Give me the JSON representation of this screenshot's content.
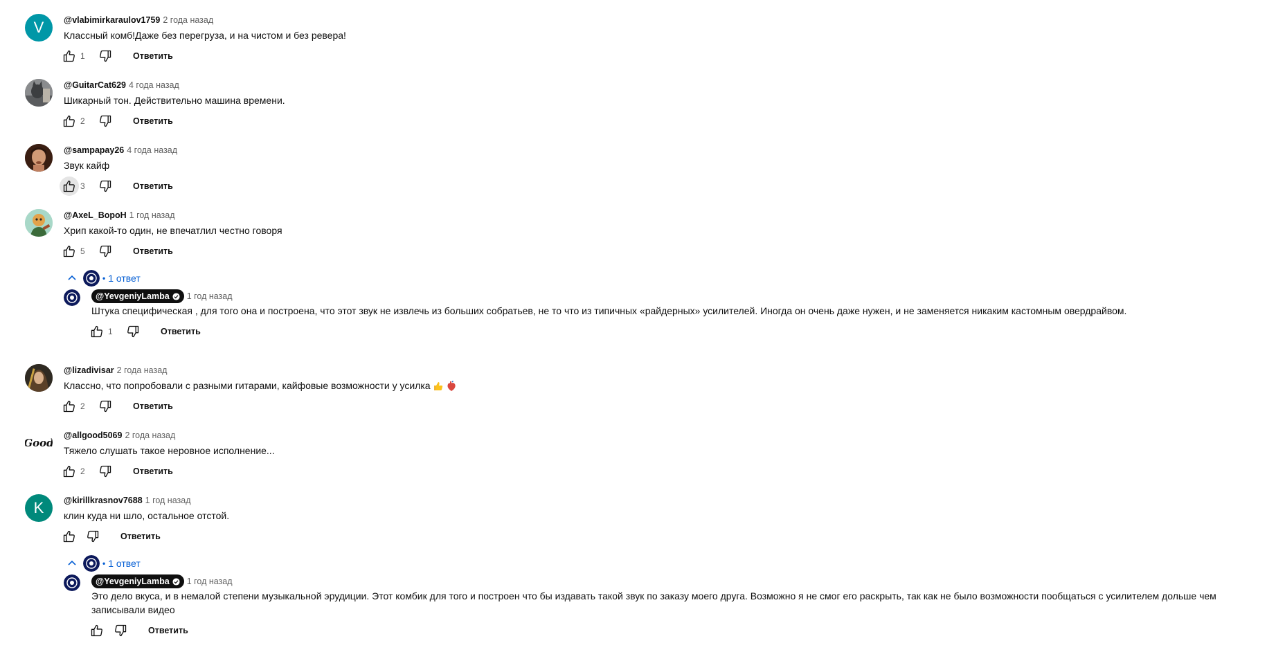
{
  "actions": {
    "reply_label": "Ответить"
  },
  "comments": [
    {
      "author": "@vlabimirkaraulov1759",
      "time": "2 года назад",
      "text": "Классный комб!Даже без перегруза, и на чистом и без ревера!",
      "likes": "1",
      "avatar": {
        "letter": "V",
        "color": "#0097a7"
      }
    },
    {
      "author": "@GuitarCat629",
      "time": "4 года назад",
      "text": "Шикарный тон. Действительно машина времени.",
      "likes": "2"
    },
    {
      "author": "@sampapay26",
      "time": "4 года назад",
      "text": "Звук кайф",
      "likes": "3"
    },
    {
      "author": "@AxeL_BopoH",
      "time": "1 год назад",
      "text": "Хрип какой-то один, не впечатлил честно говоря",
      "likes": "5",
      "replies_label": "1 ответ",
      "reply": {
        "author": "@YevgeniyLamba",
        "time": "1 год назад",
        "text": "Штука специфическая , для того она и построена, что этот звук не извлечь из больших собратьев, не то что из типичных «райдерных» усилителей. Иногда он очень даже нужен, и не заменяется никаким кастомным овердрайвом.",
        "likes": "1"
      }
    },
    {
      "author": "@lizadivisar",
      "time": "2 года назад",
      "text": "Классно, что попробовали с разными гитарами, кайфовые возможности у усилка",
      "likes": "2"
    },
    {
      "author": "@allgood5069",
      "time": "2 года назад",
      "text": "Тяжело слушать такое неровное исполнение...",
      "likes": "2",
      "avatar": {
        "word": "Good"
      }
    },
    {
      "author": "@kirillkrasnov7688",
      "time": "1 год назад",
      "text": "клин куда ни шло, остальное отстой.",
      "likes": "",
      "avatar": {
        "letter": "K",
        "color": "#00897b"
      },
      "replies_label": "1 ответ",
      "reply": {
        "author": "@YevgeniyLamba",
        "time": "1 год назад",
        "text": "Это дело вкуса, и в немалой степени музыкальной эрудиции. Этот комбик для того и построен что бы издавать такой звук по заказу моего друга. Возможно я не смог его раскрыть, так как не было возможности пообщаться с усилителем дольше чем записывали видео",
        "likes": ""
      }
    }
  ],
  "icons": {
    "like": "thumb-up-icon",
    "dislike": "thumb-down-icon",
    "collapse": "chevron-up-icon",
    "verified": "check-circle-icon",
    "emojis": [
      "thumbs-up-emoji",
      "anatomical-heart-emoji"
    ]
  }
}
